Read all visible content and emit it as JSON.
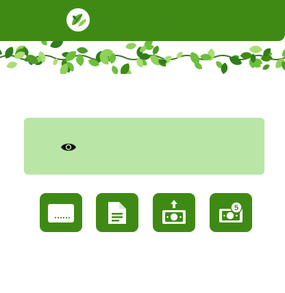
{
  "header": {
    "logo_icon": "leaf-logo-icon",
    "color": "#3f8a14"
  },
  "banner": {
    "decoration": "leaf-vine"
  },
  "balance_card": {
    "visibility_icon": "eye-icon",
    "color": "#b9e5a6"
  },
  "actions": [
    {
      "id": "card",
      "icon": "card-icon"
    },
    {
      "id": "statement",
      "icon": "document-icon"
    },
    {
      "id": "send-money",
      "icon": "cash-upload-icon"
    },
    {
      "id": "cash-count",
      "icon": "cash-badge-icon",
      "badge": "5"
    }
  ]
}
